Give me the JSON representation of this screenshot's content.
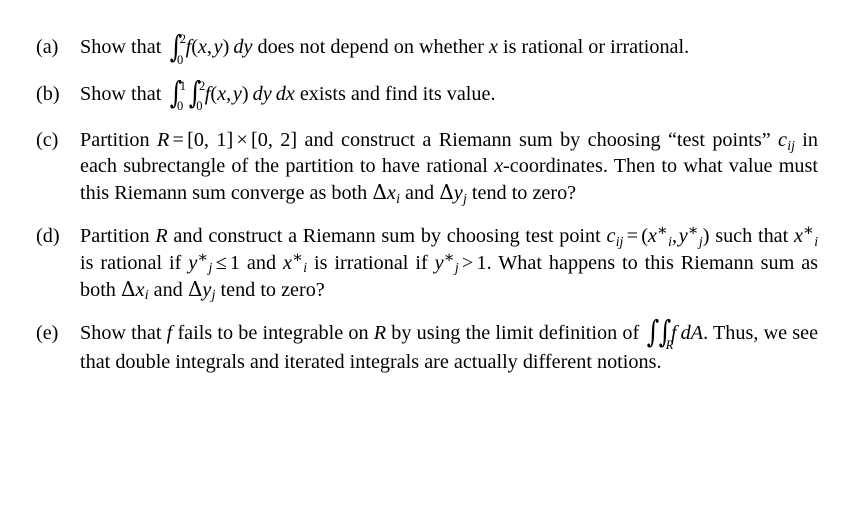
{
  "document": {
    "type": "math-exercise-list",
    "items": [
      {
        "label": "(a)",
        "id": "item-a",
        "text_plain": "Show that ∫₀² f(x, y) dy does not depend on whether x is rational or irrational.",
        "segments": {
          "s1": "Show that",
          "int_lower": "0",
          "int_upper": "2",
          "f": "f",
          "paren_open": "(",
          "var_x": "x",
          "comma": ",",
          "var_y": "y",
          "paren_close": ")",
          "dy": "dy",
          "s2": "does not depend on whether",
          "var_x2": "x",
          "s3": "is rational or irrational."
        }
      },
      {
        "label": "(b)",
        "id": "item-b",
        "text_plain": "Show that ∫₀¹ ∫₀² f(x, y) dy dx exists and find its value.",
        "segments": {
          "s1": "Show that",
          "int1_lower": "0",
          "int1_upper": "1",
          "int2_lower": "0",
          "int2_upper": "2",
          "f": "f",
          "paren_open": "(",
          "var_x": "x",
          "comma": ",",
          "var_y": "y",
          "paren_close": ")",
          "dy": "dy",
          "dx": "dx",
          "s2": "exists and find its value."
        }
      },
      {
        "label": "(c)",
        "id": "item-c",
        "text_plain": "Partition R = [0, 1] × [0, 2] and construct a Riemann sum by choosing “test points” cᵢⱼ in each subrectangle of the partition to have rational x-coordinates. Then to what value must this Riemann sum converge as both Δxᵢ and Δyⱼ tend to zero?",
        "segments": {
          "s1": "Partition",
          "var_R": "R",
          "eq": "=",
          "interval1": "[0, 1]",
          "times": "×",
          "interval2": "[0, 2]",
          "s2": "and construct a Riemann sum by choosing",
          "quote_open": "“",
          "quoted": "test points",
          "quote_close": "”",
          "var_c": "c",
          "sub_ij": "ij",
          "s3": "in each subrectangle of the partition to have rational",
          "var_x": "x",
          "s4": "-coordinates. Then to what value must this Riemann sum converge as both",
          "delta1": "Δ",
          "dvar_x": "x",
          "dsub_i": "i",
          "s5": "and",
          "delta2": "Δ",
          "dvar_y": "y",
          "dsub_j": "j",
          "s6": "tend to zero?"
        }
      },
      {
        "label": "(d)",
        "id": "item-d",
        "text_plain": "Partition R and construct a Riemann sum by choosing test point cᵢⱼ = (x*ᵢ, y*ⱼ) such that x*ᵢ is rational if y*ⱼ ≤ 1 and x*ᵢ is irrational if y*ⱼ > 1. What happens to this Riemann sum as both Δxᵢ and Δyⱼ tend to zero?",
        "segments": {
          "s1": "Partition",
          "var_R": "R",
          "s2": "and construct a Riemann sum by choosing test point",
          "var_c": "c",
          "sub_ij": "ij",
          "eq": "=",
          "paren_open": "(",
          "var_x": "x",
          "star": "∗",
          "sub_i": "i",
          "comma": ",",
          "var_y": "y",
          "sub_j": "j",
          "paren_close": ")",
          "s3": "such that",
          "s4": "is rational if",
          "leq": "≤",
          "one_a": "1",
          "s5": "and",
          "s6": "is irrational if",
          "gt": ">",
          "one_b": "1.",
          "s7": "What happens to this Riemann sum as both",
          "delta1": "Δ",
          "dvar_x": "x",
          "dsub_i": "i",
          "s8": "and",
          "delta2": "Δ",
          "dvar_y": "y",
          "dsub_j": "j",
          "s9": "tend to zero?"
        }
      },
      {
        "label": "(e)",
        "id": "item-e",
        "text_plain": "Show that f fails to be integrable on R by using the limit definition of ∬_R f dA. Thus, we see that double integrals and iterated integrals are actually different notions.",
        "segments": {
          "s1": "Show that",
          "var_f": "f",
          "s2": "fails to be integrable on",
          "var_R": "R",
          "s3": "by using the limit definition of",
          "dblint_sub": "R",
          "f2": "f",
          "dA": "dA",
          "period": ".",
          "s4": "Thus, we see that double integrals and iterated integrals are actually different notions."
        }
      }
    ]
  },
  "style": {
    "text_color": "#000000",
    "background_color": "#ffffff"
  }
}
